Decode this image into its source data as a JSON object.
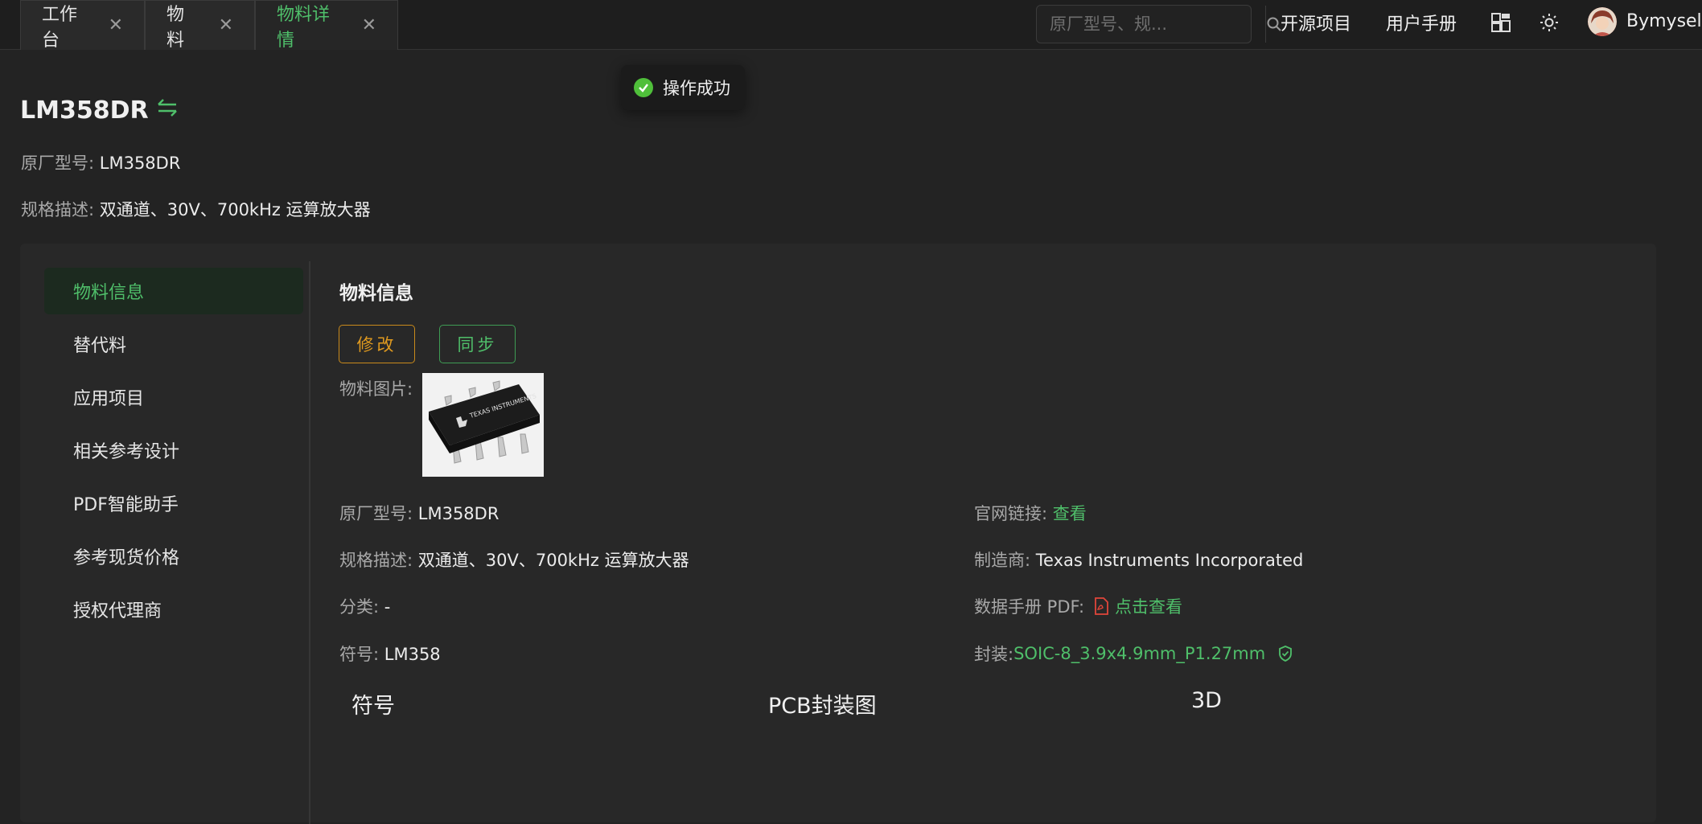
{
  "tabs": [
    {
      "label": "工作台",
      "active": false
    },
    {
      "label": "物料",
      "active": false
    },
    {
      "label": "物料详情",
      "active": true
    }
  ],
  "search": {
    "placeholder": "原厂型号、规..."
  },
  "top_links": {
    "open_source": "开源项目",
    "manual": "用户手册"
  },
  "user": {
    "name": "Bymyself"
  },
  "toast": {
    "message": "操作成功"
  },
  "part": {
    "title": "LM358DR",
    "model_label": "原厂型号:",
    "model_value": "LM358DR",
    "spec_label": "规格描述:",
    "spec_value": "双通道、30V、700kHz 运算放大器"
  },
  "sidebar": {
    "items": [
      {
        "label": "物料信息",
        "active": true
      },
      {
        "label": "替代料",
        "active": false
      },
      {
        "label": "应用项目",
        "active": false
      },
      {
        "label": "相关参考设计",
        "active": false
      },
      {
        "label": "PDF智能助手",
        "active": false
      },
      {
        "label": "参考现货价格",
        "active": false
      },
      {
        "label": "授权代理商",
        "active": false
      }
    ]
  },
  "detail": {
    "section_title": "物料信息",
    "edit_label": "修改",
    "sync_label": "同步",
    "image_label": "物料图片:",
    "chip_text": "TEXAS INSTRUMENTS",
    "left_fields": {
      "model_label": "原厂型号:",
      "model_value": "LM358DR",
      "spec_label": "规格描述:",
      "spec_value": "双通道、30V、700kHz 运算放大器",
      "category_label": "分类:",
      "category_value": "-",
      "symbol_label": "符号:",
      "symbol_value": "LM358"
    },
    "right_fields": {
      "website_label": "官网链接:",
      "website_value": "查看",
      "manufacturer_label": "制造商:",
      "manufacturer_value": "Texas Instruments Incorporated",
      "datasheet_label": "数据手册 PDF:",
      "datasheet_value": "点击查看",
      "package_label": "封装:",
      "package_value": "SOIC-8_3.9x4.9mm_P1.27mm"
    },
    "bottom_tabs": {
      "symbol": "符号",
      "pcb": "PCB封装图",
      "three_d": "3D"
    }
  },
  "colors": {
    "accent_green": "#4fbf6a",
    "edit_orange": "#e09a1f",
    "pdf_red": "#e0453a",
    "background": "#232323"
  },
  "icons": [
    "close-icon",
    "search-icon",
    "layout-icon",
    "sun-icon",
    "check-icon",
    "swap-icon",
    "pdf-icon",
    "verified-icon"
  ]
}
